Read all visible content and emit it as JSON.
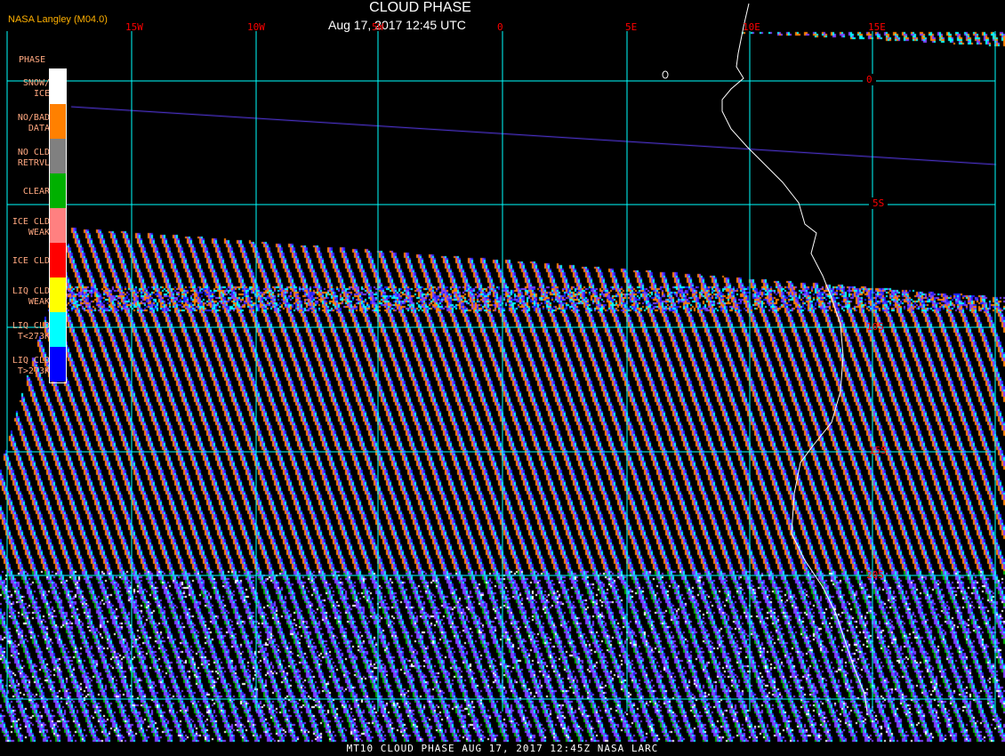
{
  "header": {
    "title": "CLOUD PHASE",
    "datetime": "Aug 17, 2017 12:45 UTC",
    "credit": "NASA Langley (M04.0)"
  },
  "map": {
    "longitude_labels": [
      "15W",
      "10W",
      "5W",
      "0",
      "5E",
      "10E",
      "15E"
    ],
    "latitude_labels": [
      "0",
      "5S",
      "10S",
      "15S",
      "20S"
    ],
    "grid_color": "#00ffff",
    "label_color": "#ff0000",
    "coastline_color": "#ffffff"
  },
  "legend": {
    "title": "PHASE",
    "items": [
      {
        "label1": "SNOW/",
        "label2": "ICE",
        "color": "#ffffff"
      },
      {
        "label1": "NO/BAD",
        "label2": "DATA",
        "color": "#ff8000"
      },
      {
        "label1": "NO CLD",
        "label2": "RETRVL",
        "color": "#808080"
      },
      {
        "label1": "CLEAR",
        "label2": "",
        "color": "#00b000"
      },
      {
        "label1": "ICE CLD",
        "label2": "WEAK",
        "color": "#ff8080"
      },
      {
        "label1": "ICE CLD",
        "label2": "",
        "color": "#ff0000"
      },
      {
        "label1": "LIQ CLD",
        "label2": "WEAK",
        "color": "#ffff00"
      },
      {
        "label1": "LIQ CLD",
        "label2": "T<273K",
        "color": "#00ffff"
      },
      {
        "label1": "LIQ CLD",
        "label2": "T>273K",
        "color": "#0000ff"
      }
    ]
  },
  "footer": {
    "text": "MT10  CLOUD PHASE  AUG 17, 2017 12:45Z  NASA LARC"
  }
}
